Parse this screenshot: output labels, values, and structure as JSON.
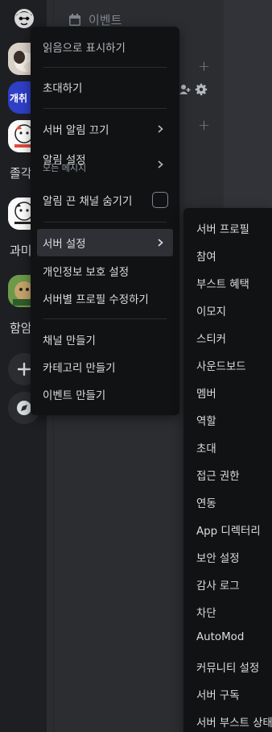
{
  "header": {
    "events_label": "이벤트"
  },
  "rail": {
    "text_servers": [
      "졸각",
      "과미",
      "함암"
    ]
  },
  "context_menu": {
    "mark_read": "읽음으로 표시하기",
    "invite": "초대하기",
    "mute_server": "서버 알림 끄기",
    "notification_settings": "알림 설정",
    "notification_settings_sub": "모든 메시지",
    "hide_muted_channels": "알림 끈 채널 숨기기",
    "server_settings": "서버 설정",
    "privacy_settings": "개인정보 보호 설정",
    "edit_server_profile": "서버별 프로필 수정하기",
    "create_channel": "채널 만들기",
    "create_category": "카테고리 만들기",
    "create_event": "이벤트 만들기"
  },
  "submenu": {
    "items": [
      "서버 프로필",
      "참여",
      "부스트 혜택",
      "이모지",
      "스티커",
      "사운드보드",
      "멤버",
      "역할",
      "초대",
      "접근 권한",
      "연동",
      "App 디렉터리",
      "보안 설정",
      "감사 로그",
      "차단",
      "AutoMod",
      "커뮤니티 설정",
      "서버 구독",
      "서버 부스트 상태"
    ]
  },
  "colors": {
    "menu_bg": "#111214",
    "active_bg": "#2e3035",
    "server_blue": "#3b4ad6"
  }
}
